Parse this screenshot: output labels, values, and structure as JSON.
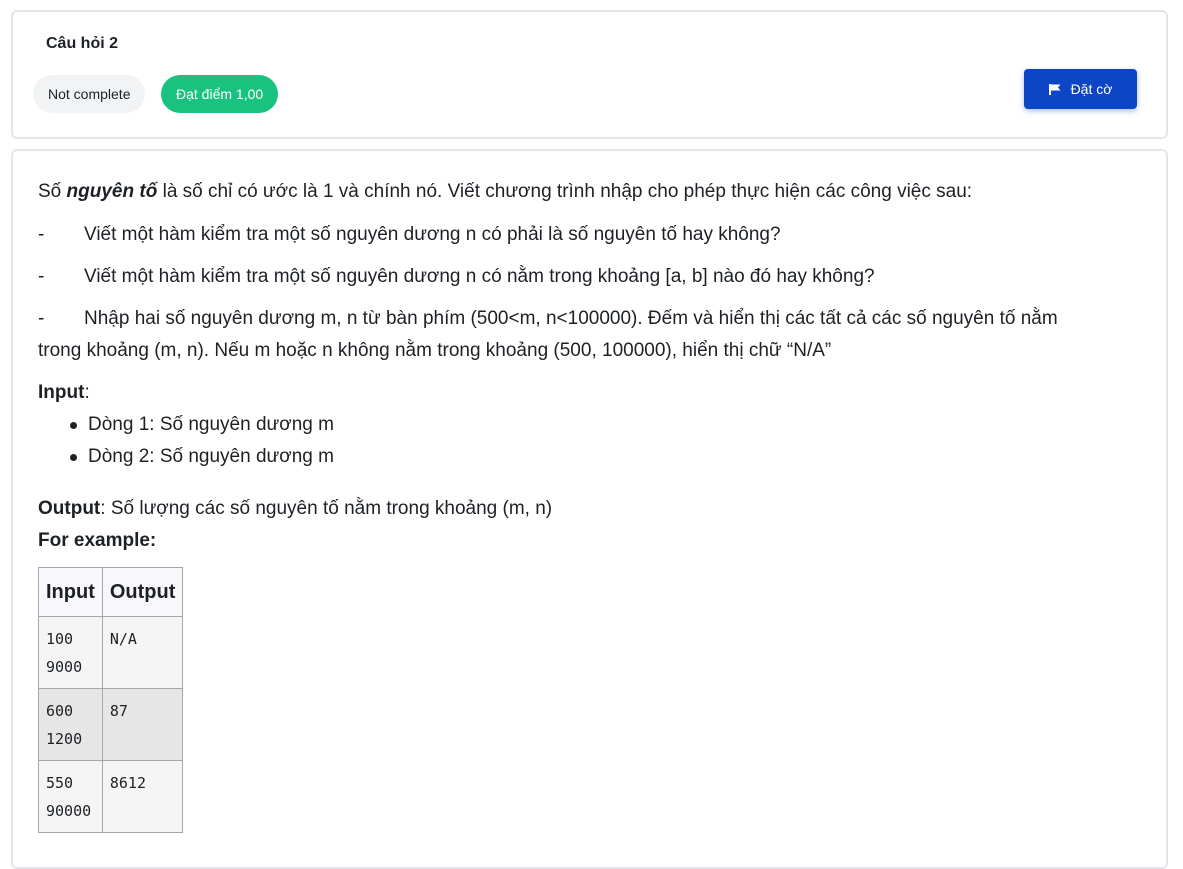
{
  "question": {
    "title": "Câu hỏi 2",
    "status": "Not complete",
    "grade": "Đạt điểm 1,00",
    "flag_label": "Đặt cờ",
    "flag_icon": "flag-icon"
  },
  "colors": {
    "grade_badge": "#19c27e",
    "flag_button": "#0c45c6"
  },
  "body": {
    "intro_prefix": "Số ",
    "intro_bold": "nguyên tố",
    "intro_suffix": " là số chỉ có ước là 1 và chính nó. Viết chương trình nhập cho phép thực hiện các công việc sau:",
    "dash": "-",
    "tasks": [
      "Viết một hàm kiểm tra một số nguyên dương n có phải là số nguyên tố hay không?",
      "Viết một hàm kiểm tra một số nguyên dương n có nằm trong khoảng [a, b] nào đó hay không?",
      "Nhập hai số nguyên dương m, n từ bàn phím (500<m, n<100000). Đếm và hiển thị các tất cả các số nguyên tố nằm"
    ],
    "task3_continued": "trong khoảng (m, n). Nếu m hoặc n không nằm trong khoảng (500, 100000), hiển thị chữ “N/A”",
    "input_label": "Input",
    "input_colon": ":",
    "input_items": [
      "Dòng 1: Số nguyên dương m",
      "Dòng 2: Số nguyên dương m"
    ],
    "output_label": "Output",
    "output_text": ": Số lượng các số nguyên tố nằm trong khoảng (m, n)",
    "example_label": "For example:"
  },
  "example_table": {
    "headers": [
      "Input",
      "Output"
    ],
    "rows": [
      {
        "input": [
          "100",
          "9000"
        ],
        "output": "N/A"
      },
      {
        "input": [
          "600",
          "1200"
        ],
        "output": "87"
      },
      {
        "input": [
          "550",
          "90000"
        ],
        "output": "8612"
      }
    ]
  }
}
